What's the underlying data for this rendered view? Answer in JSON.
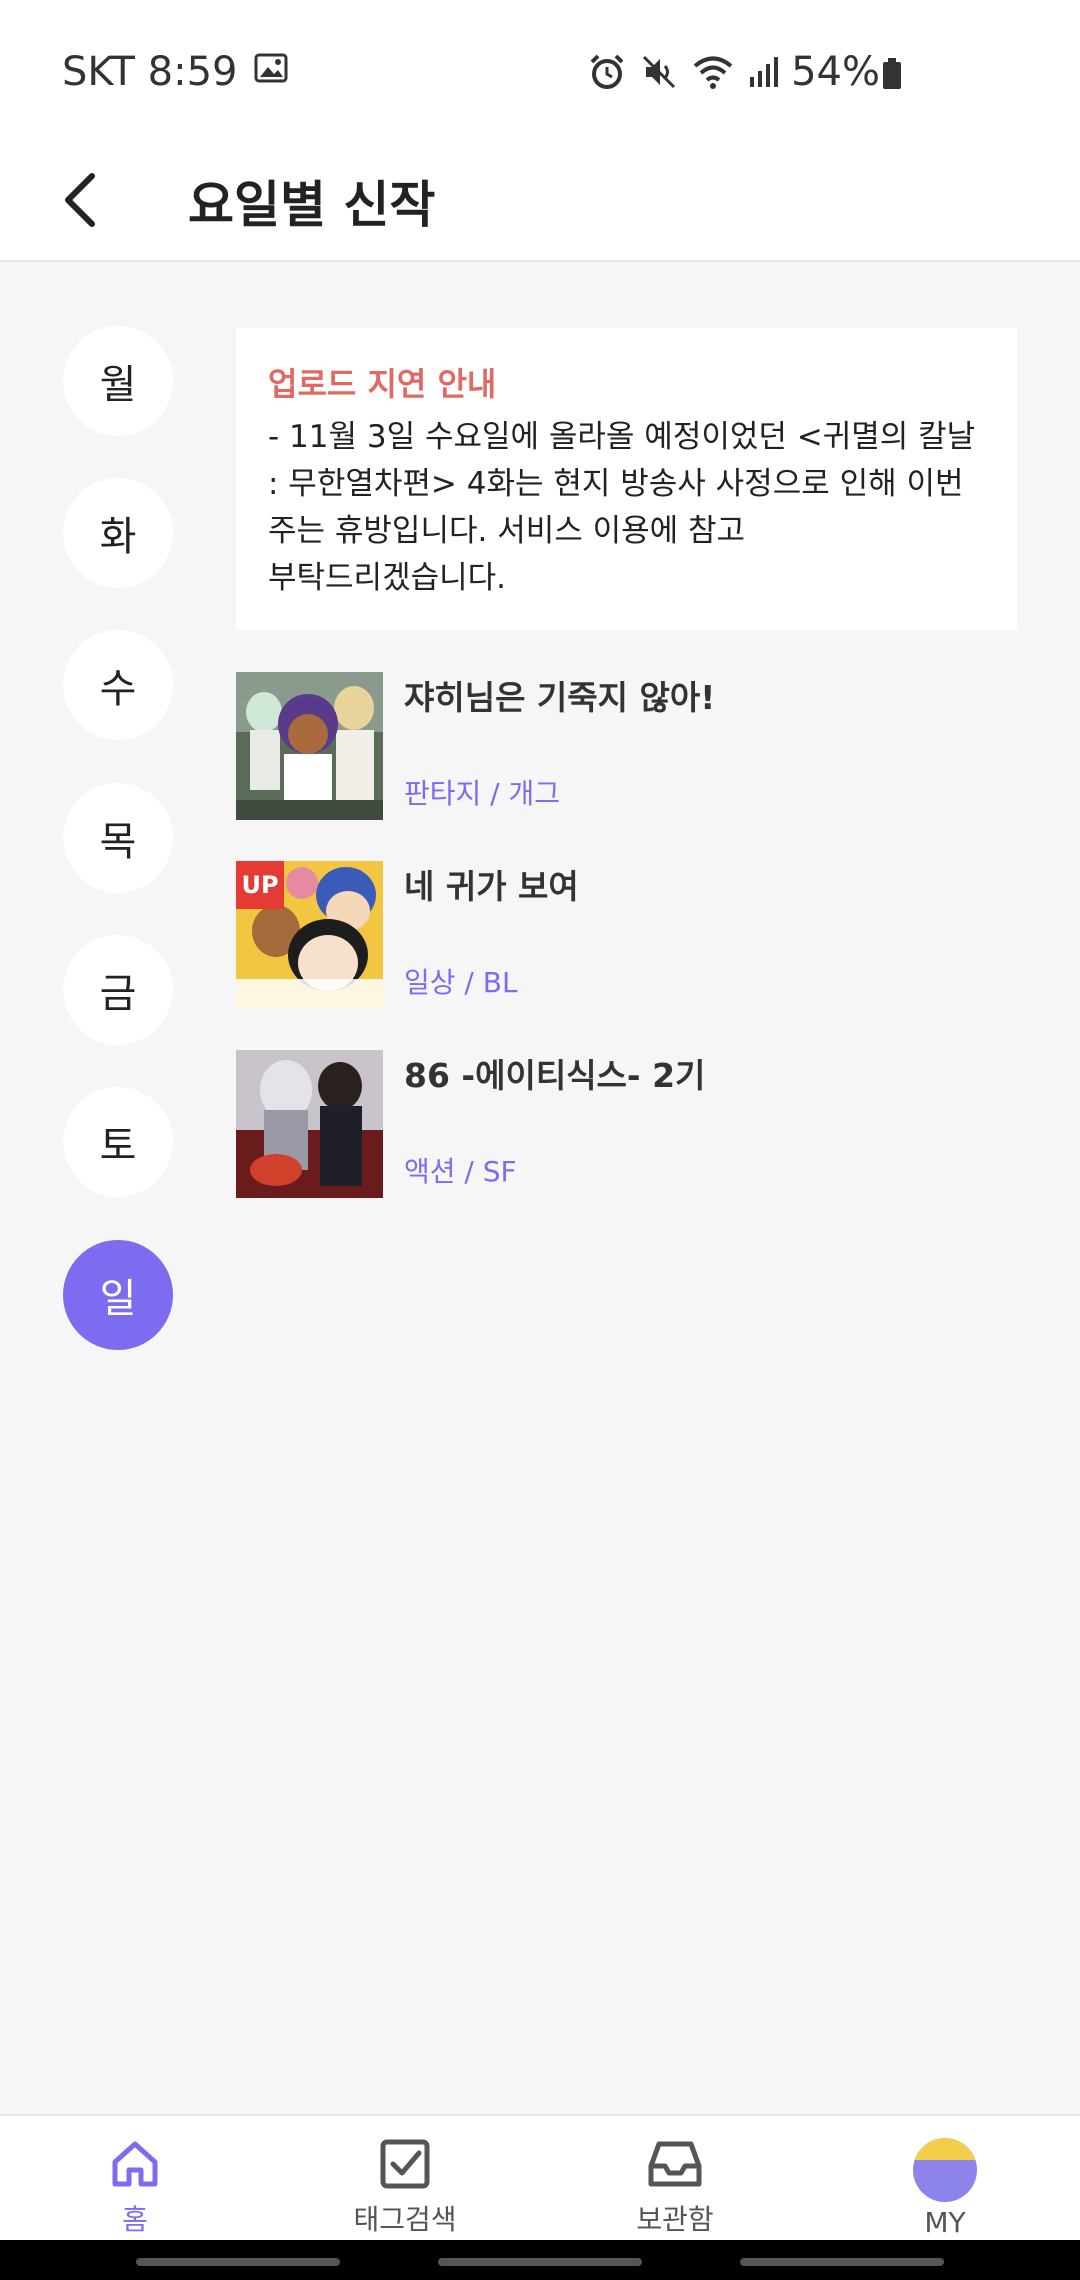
{
  "status_bar": {
    "carrier_time": "SKT 8:59",
    "battery": "54%",
    "icons": [
      "image-icon",
      "alarm-icon",
      "mute-icon",
      "wifi-icon",
      "signal-icon",
      "battery-icon"
    ]
  },
  "header": {
    "title": "요일별 신작",
    "back_icon": "back-arrow-icon"
  },
  "days": [
    {
      "label": "월",
      "active": false
    },
    {
      "label": "화",
      "active": false
    },
    {
      "label": "수",
      "active": false
    },
    {
      "label": "목",
      "active": false
    },
    {
      "label": "금",
      "active": false
    },
    {
      "label": "토",
      "active": false
    },
    {
      "label": "일",
      "active": true
    }
  ],
  "notice": {
    "title": "업로드 지연 안내",
    "body": "- 11월 3일 수요일에 올라올 예정이었던 <귀멸의 칼날 : 무한열차편> 4화는 현지 방송사 사정으로 인해 이번 주는 휴방입니다. 서비스 이용에 참고 부탁드리겠습니다."
  },
  "comics": [
    {
      "title": "쟈히님은 기죽지 않아!",
      "genre": "판타지 / 개그",
      "badge": ""
    },
    {
      "title": "네 귀가 보여",
      "genre": "일상 / BL",
      "badge": "UP"
    },
    {
      "title": "86 -에이티식스- 2기",
      "genre": "액션 / SF",
      "badge": ""
    }
  ],
  "bottom_nav": [
    {
      "label": "홈",
      "icon": "home-icon",
      "active": true
    },
    {
      "label": "태그검색",
      "icon": "checkbox-icon",
      "active": false
    },
    {
      "label": "보관함",
      "icon": "inbox-icon",
      "active": false
    },
    {
      "label": "MY",
      "icon": "avatar-icon",
      "active": false
    }
  ],
  "colors": {
    "accent": "#7b6cf0",
    "notice_title": "#e06a63",
    "background": "#f6f6f7"
  }
}
